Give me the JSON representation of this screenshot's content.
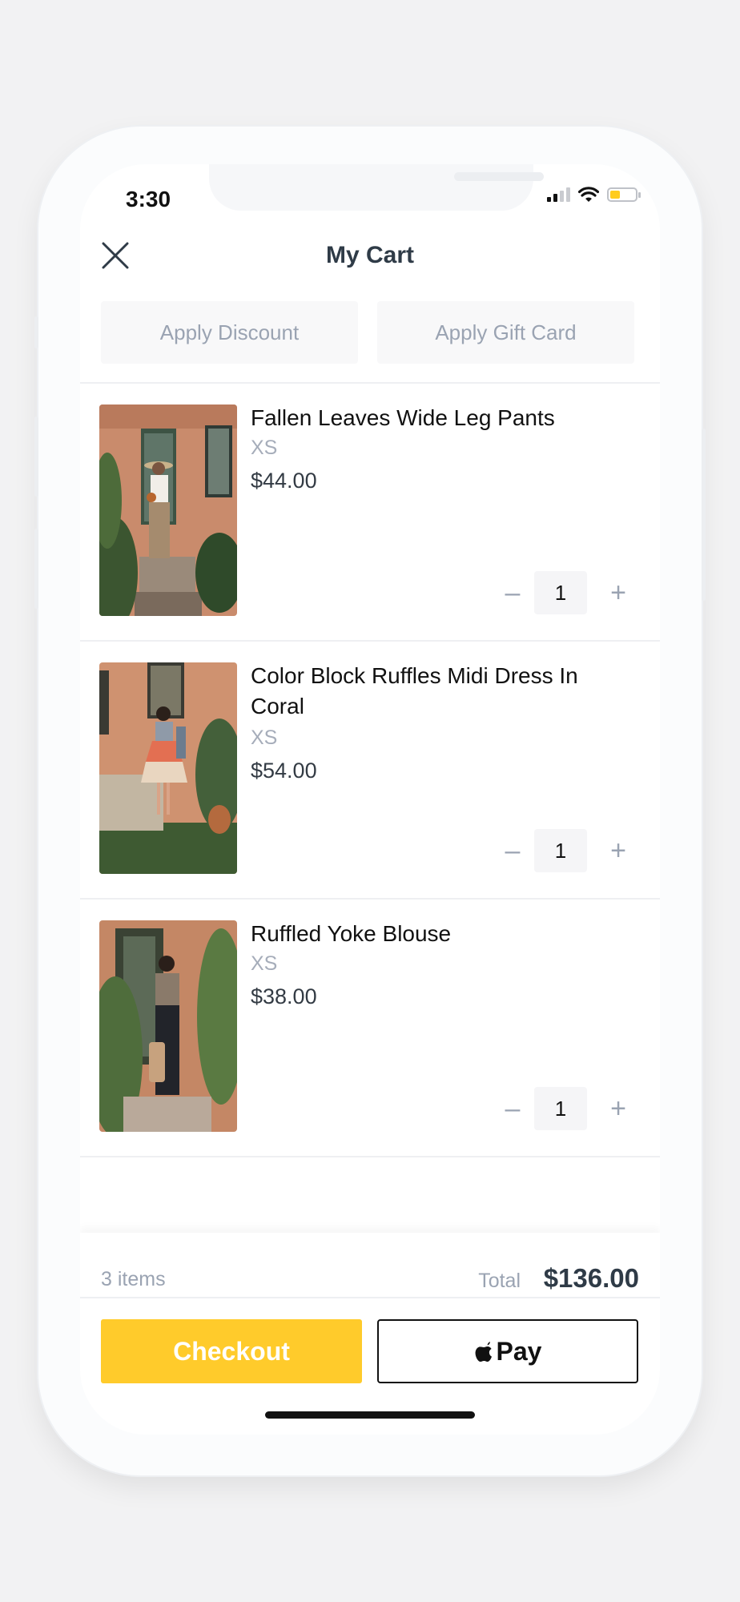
{
  "status_bar": {
    "time": "3:30"
  },
  "header": {
    "title": "My Cart"
  },
  "actions": {
    "discount_label": "Apply Discount",
    "gift_card_label": "Apply Gift Card"
  },
  "items": [
    {
      "name": "Fallen Leaves Wide Leg Pants",
      "size": "XS",
      "price": "$44.00",
      "quantity": "1"
    },
    {
      "name": "Color Block Ruffles Midi Dress In Coral",
      "size": "XS",
      "price": "$54.00",
      "quantity": "1"
    },
    {
      "name": "Ruffled Yoke Blouse",
      "size": "XS",
      "price": "$38.00",
      "quantity": "1"
    }
  ],
  "summary": {
    "items_count": "3 items",
    "total_label": "Total",
    "total_value": "$136.00"
  },
  "buttons": {
    "checkout_label": "Checkout",
    "apple_pay_label": "Pay"
  },
  "icons": {
    "close": "close-icon",
    "minus": "minus-icon",
    "plus": "plus-icon",
    "apple": "apple-logo-icon"
  },
  "colors": {
    "accent": "#ffcb2b",
    "muted_text": "#9aa3b2",
    "title_text": "#2f3b47"
  }
}
